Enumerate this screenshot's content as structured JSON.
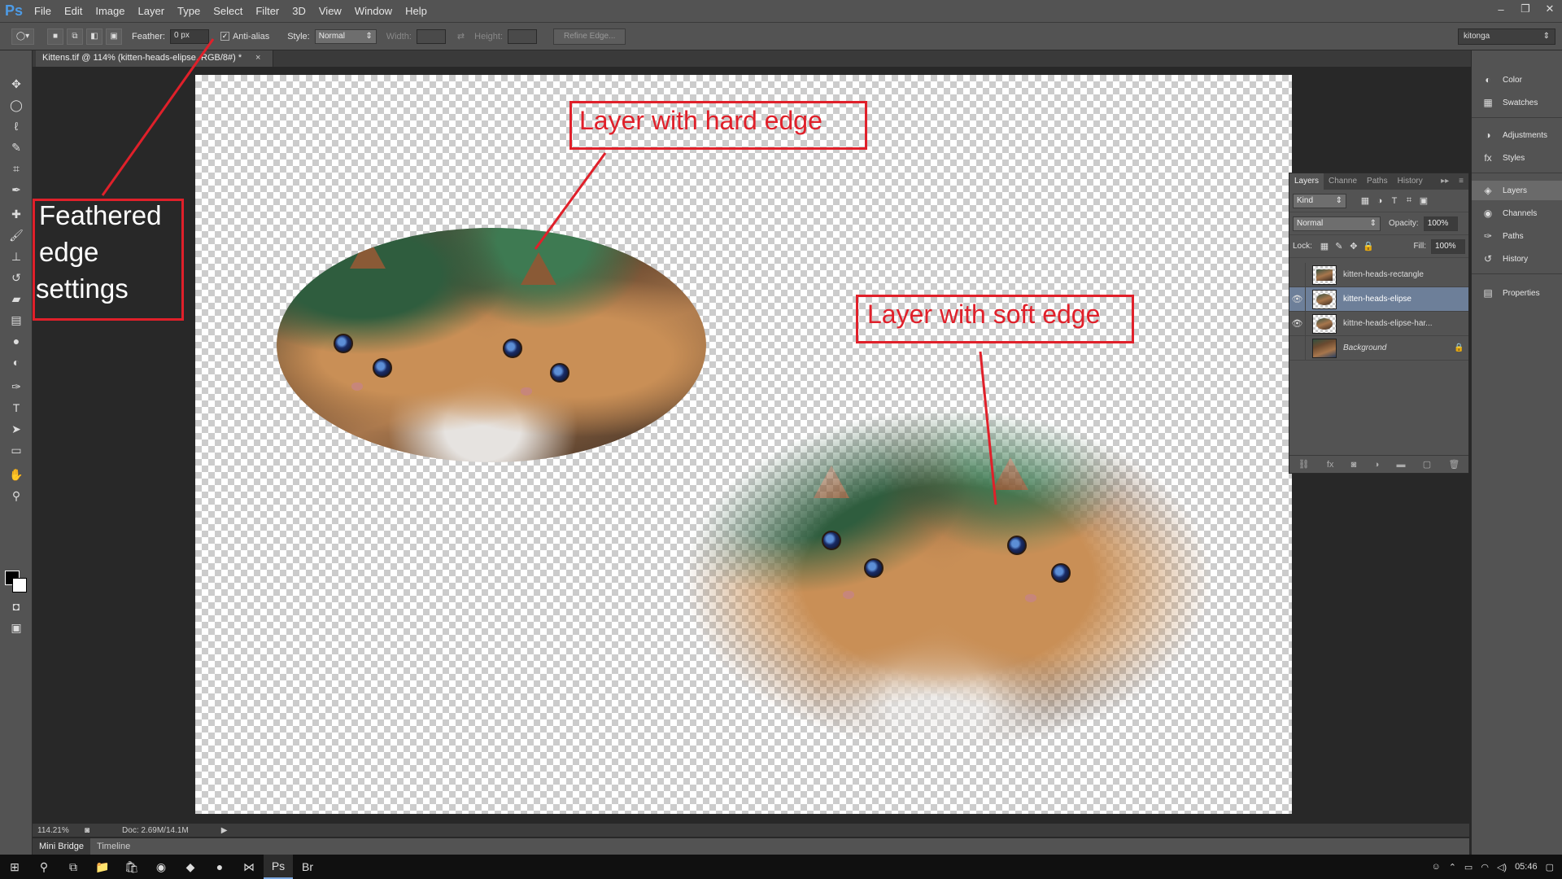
{
  "app": {
    "logo": "Ps"
  },
  "menu": [
    "File",
    "Edit",
    "Image",
    "Layer",
    "Type",
    "Select",
    "Filter",
    "3D",
    "View",
    "Window",
    "Help"
  ],
  "window_controls": {
    "minimize": "‒",
    "restore": "❐",
    "close": "✕"
  },
  "options": {
    "feather_label": "Feather:",
    "feather_value": "0 px",
    "antialias_label": "Anti-alias",
    "antialias_checked": true,
    "style_label": "Style:",
    "style_value": "Normal",
    "width_label": "Width:",
    "height_label": "Height:",
    "refine_edge": "Refine Edge...",
    "workspace": "kitonga"
  },
  "document_tab": {
    "title": "Kittens.tif @ 114% (kitten-heads-elipse, RGB/8#) *",
    "close": "×"
  },
  "annotations": {
    "hard_edge": "Layer with hard edge",
    "soft_edge": "Layer with soft edge",
    "feathered_line1": "Feathered",
    "feathered_line2": "edge",
    "feathered_line3": "settings",
    "color": "#e0202a"
  },
  "status": {
    "zoom": "114.21%",
    "doc": "Doc: 2.69M/14.1M"
  },
  "bottom_tabs": [
    "Mini Bridge",
    "Timeline"
  ],
  "layers_panel": {
    "tabs": [
      "Layers",
      "Channe",
      "Paths",
      "History"
    ],
    "kind_label": "Kind",
    "blend_mode": "Normal",
    "opacity_label": "Opacity:",
    "opacity_value": "100%",
    "lock_label": "Lock:",
    "fill_label": "Fill:",
    "fill_value": "100%",
    "layers": [
      {
        "name": "kitten-heads-rectangle",
        "visible": false,
        "selected": false
      },
      {
        "name": "kitten-heads-elipse",
        "visible": true,
        "selected": true
      },
      {
        "name": "kittne-heads-elipse-har...",
        "visible": true,
        "selected": false
      },
      {
        "name": "Background",
        "visible": false,
        "selected": false,
        "locked": true
      }
    ]
  },
  "dock": {
    "color": "Color",
    "swatches": "Swatches",
    "adjustments": "Adjustments",
    "styles": "Styles",
    "layers": "Layers",
    "channels": "Channels",
    "paths": "Paths",
    "history": "History",
    "properties": "Properties"
  },
  "taskbar": {
    "time": "05:46"
  }
}
